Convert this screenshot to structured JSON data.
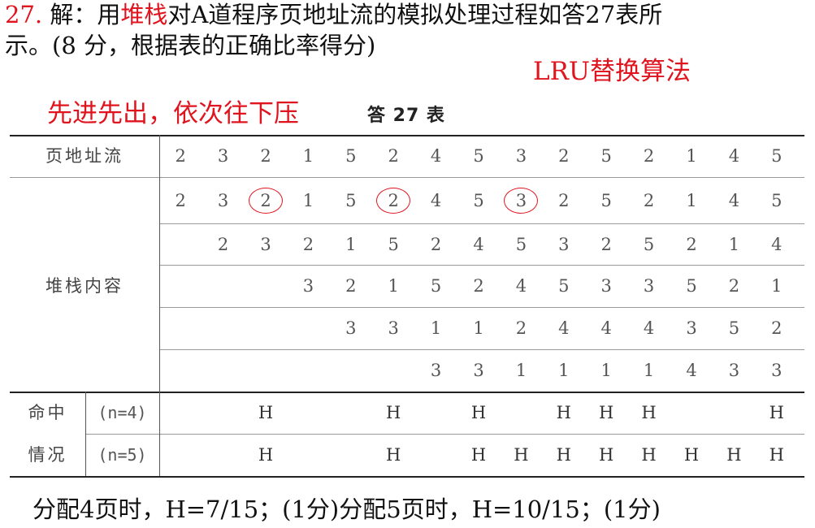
{
  "question": {
    "line1": [
      {
        "text": "27.",
        "color": "#e0141e"
      },
      {
        "text": " 解：用",
        "color": "#111111"
      },
      {
        "text": "堆栈",
        "color": "#e0141e"
      },
      {
        "text": "对A道程序页地址流的模拟处理过程如答27表所",
        "color": "#111111"
      }
    ],
    "line2": "示。(8 分，根据表的正确比率得分)"
  },
  "annotations": {
    "right": "LRU替换算法",
    "left": "先进先出，依次往下压"
  },
  "table": {
    "caption": "答 27 表",
    "page_stream_label": "页地址流",
    "page_stream": [
      "2",
      "3",
      "2",
      "1",
      "5",
      "2",
      "4",
      "5",
      "3",
      "2",
      "5",
      "2",
      "1",
      "4",
      "5"
    ],
    "stack_label": "堆栈内容",
    "stack_rows": [
      [
        "2",
        "3",
        "2",
        "1",
        "5",
        "2",
        "4",
        "5",
        "3",
        "2",
        "5",
        "2",
        "1",
        "4",
        "5"
      ],
      [
        "",
        "2",
        "3",
        "2",
        "1",
        "5",
        "2",
        "4",
        "5",
        "3",
        "2",
        "5",
        "2",
        "1",
        "4"
      ],
      [
        "",
        "",
        "3",
        "2",
        "1",
        "5",
        "2",
        "4",
        "5",
        "3",
        "3",
        "5",
        "2",
        "1"
      ],
      [
        "",
        "",
        "",
        "3",
        "3",
        "1",
        "1",
        "2",
        "4",
        "4",
        "4",
        "3",
        "5",
        "2"
      ],
      [
        "",
        "",
        "",
        "",
        "",
        "3",
        "3",
        "1",
        "1",
        "1",
        "1",
        "4",
        "3",
        "3"
      ]
    ],
    "circled": [
      2,
      5,
      8
    ],
    "hit_label_line1": "命中",
    "hit_label_line2": "情况",
    "hit_rows": [
      {
        "label": "(n=4)",
        "values": [
          "",
          "",
          "H",
          "",
          "",
          "H",
          "",
          "H",
          "",
          "H",
          "H",
          "H",
          "",
          "",
          "H"
        ]
      },
      {
        "label": "(n=5)",
        "values": [
          "",
          "",
          "H",
          "",
          "",
          "H",
          "",
          "H",
          "H",
          "H",
          "H",
          "H",
          "H",
          "H",
          "H"
        ]
      }
    ]
  },
  "footer": "分配4页时，H=7/15；(1分)分配5页时，H=10/15；(1分)"
}
